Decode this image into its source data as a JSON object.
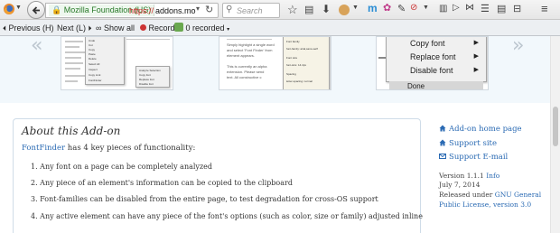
{
  "browser": {
    "identity": "Mozilla Foundation (US)",
    "url_prefix": "https://",
    "url_host": "addons.mo",
    "search_placeholder": "Search"
  },
  "findbar": {
    "previous": "Previous",
    "previous_key": "(H)",
    "next": "Next",
    "next_key": "(L)",
    "show_all": "Show all",
    "record": "Record",
    "recorded": "0 recorded"
  },
  "screenshots": {
    "context_menu": [
      {
        "label": "Copy font"
      },
      {
        "label": "Replace font"
      },
      {
        "label": "Disable font"
      }
    ],
    "done_label": "Done",
    "shot1_menu": [
      "Undo",
      "Cut",
      "Copy",
      "Paste",
      "Delete",
      "Select All",
      "Inspect",
      "Copy Link",
      "FontFinder"
    ],
    "shot1_sub": [
      "Analyze Selection",
      "Copy font",
      "Replace font",
      "Disable font"
    ],
    "shot2_text": [
      "Simply highlight a single word",
      "and select 'Font Finder' from",
      "element appears.",
      "This is currently an alpha",
      "extension. Please send",
      "text. All constructive c"
    ],
    "shot2_panel": [
      "Font family",
      "font-family: arial,sans-serif",
      "Font size",
      "font-size: 14.4px",
      "Spacing",
      "letter-spacing: normal"
    ]
  },
  "about": {
    "title": "About this Add-on",
    "intro_link": "FontFinder",
    "intro_rest": " has 4 key pieces of functionality:",
    "features": [
      "1. Any font on a page can be completely analyzed",
      "2. Any piece of an element's information can be copied to the clipboard",
      "3. Font-families can be disabled from the entire page, to test degradation for cross-OS support",
      "4. Any active element can have any piece of the font's options (such as color, size or family) adjusted inline"
    ]
  },
  "sidebar": {
    "links": [
      {
        "label": "Add-on home page"
      },
      {
        "label": "Support site"
      },
      {
        "label": "Support E-mail"
      }
    ],
    "version_label": "Version 1.1.1",
    "version_info": "Info",
    "date": "July 7, 2014",
    "license_prefix": "Released under",
    "license_link_1": "GNU General",
    "license_link_2": "Public License, version 3.0"
  },
  "colors": {
    "link": "#2a6ab3",
    "url_red": "#d02a2a",
    "secure_green": "#2a7a2a"
  }
}
